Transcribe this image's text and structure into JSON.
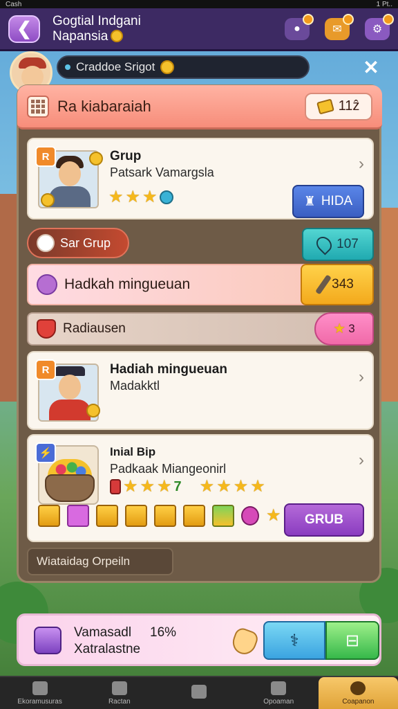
{
  "status_bar": {
    "left": "Cash",
    "right": "1 Pt.."
  },
  "header": {
    "title_line1": "Gogtial Indgani",
    "title_line2": "Napansia",
    "back_label": "❮"
  },
  "player": {
    "name": "Craddoe Srigot",
    "close_label": "✕"
  },
  "panel": {
    "title": "Ra kiabaraiah",
    "score": "11ẑ",
    "footer_label": "Wiataidag Orpeiln"
  },
  "card1": {
    "badge": "R",
    "title": "Grup",
    "subtitle": "Patsark Vamargsla",
    "stars": 3,
    "button_label": "HIDA"
  },
  "row_sar": {
    "label": "Sar Grup",
    "button_label": "107"
  },
  "row_hadiah": {
    "label": "Hadkah mingueuan",
    "button_label": "343"
  },
  "row_radia": {
    "label": "Radiausen",
    "tag_label": "3"
  },
  "card2": {
    "badge": "R",
    "title": "Hadiah mingueuan",
    "subtitle": "Madakktl"
  },
  "card3": {
    "title": "Inial Bip",
    "subtitle": "Padkaak Miangeonirl",
    "stars_label": "7",
    "button_label": "GRUB"
  },
  "promo": {
    "line1": "Vamasadl",
    "pct": "16%",
    "line2": "Xatralastne",
    "btn_blue_label": "⚕",
    "btn_green_label": "⊟"
  },
  "nav": [
    {
      "label": "Ekoramusuras"
    },
    {
      "label": "Ractan"
    },
    {
      "label": ""
    },
    {
      "label": "Opoaman"
    },
    {
      "label": "Coapanon"
    }
  ],
  "colors": {
    "header_bg": "#3d2a63",
    "panel_head": "#f78d7a",
    "accent_purple": "#8a3cc0",
    "accent_teal": "#20aab0",
    "accent_yellow": "#f3a91c"
  }
}
